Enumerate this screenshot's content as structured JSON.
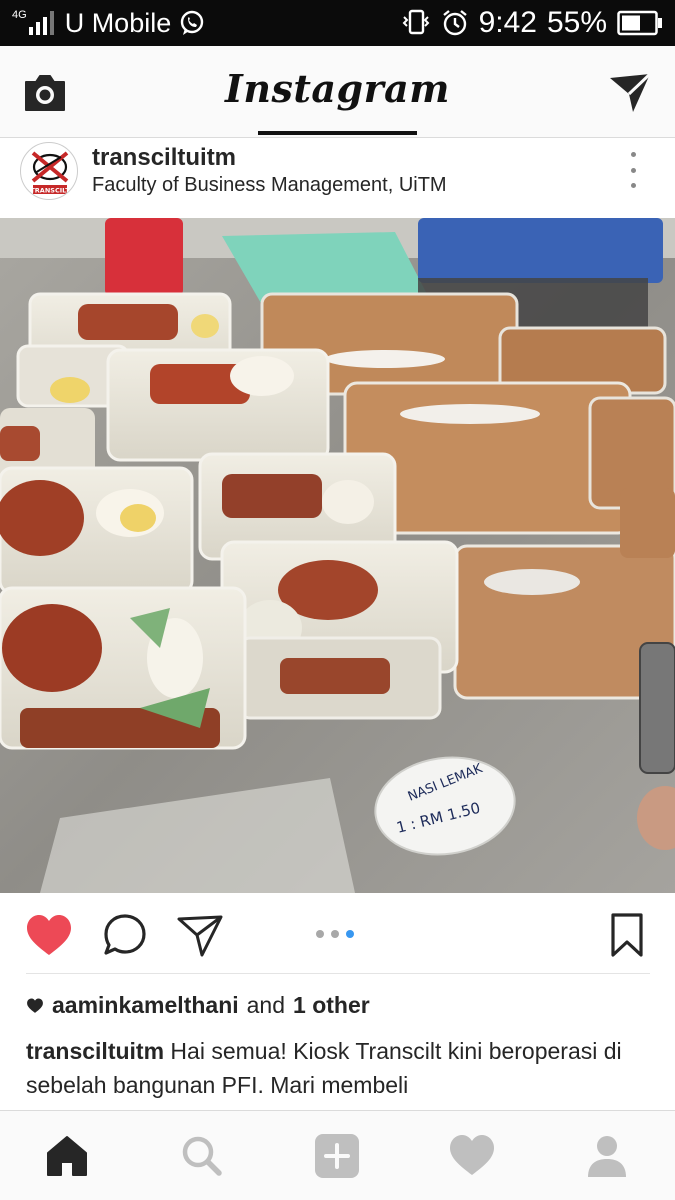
{
  "status_bar": {
    "network_type": "4G",
    "carrier": "U Mobile",
    "time": "9:42",
    "battery": "55%"
  },
  "header": {
    "logo": "Instagram",
    "icons": [
      "camera-icon",
      "direct-message-icon"
    ]
  },
  "post": {
    "username": "transciltuitm",
    "location": "Faculty of Business Management, UiTM",
    "avatar_text": "TRANSCILT",
    "photo_sign": {
      "line1": "NASI LEMAK",
      "line2": "1 : RM 1.50"
    },
    "carousel": {
      "count": 3,
      "active_index": 2
    },
    "liked": true,
    "likes": {
      "first_user": "aaminkamelthani",
      "connector": "and",
      "others": "1 other"
    },
    "caption": {
      "user": "transciltuitm",
      "text": "Hai semua! Kiosk Transcilt kini beroperasi di sebelah bangunan PFI. Mari membeli"
    }
  },
  "tab_bar": {
    "items": [
      "home-icon",
      "search-icon",
      "add-post-icon",
      "activity-heart-icon",
      "profile-icon"
    ],
    "active": "home-icon"
  },
  "colors": {
    "like_red": "#ed4956",
    "carousel_blue": "#3897f0",
    "status_bar_bg": "#0b0b0b"
  }
}
